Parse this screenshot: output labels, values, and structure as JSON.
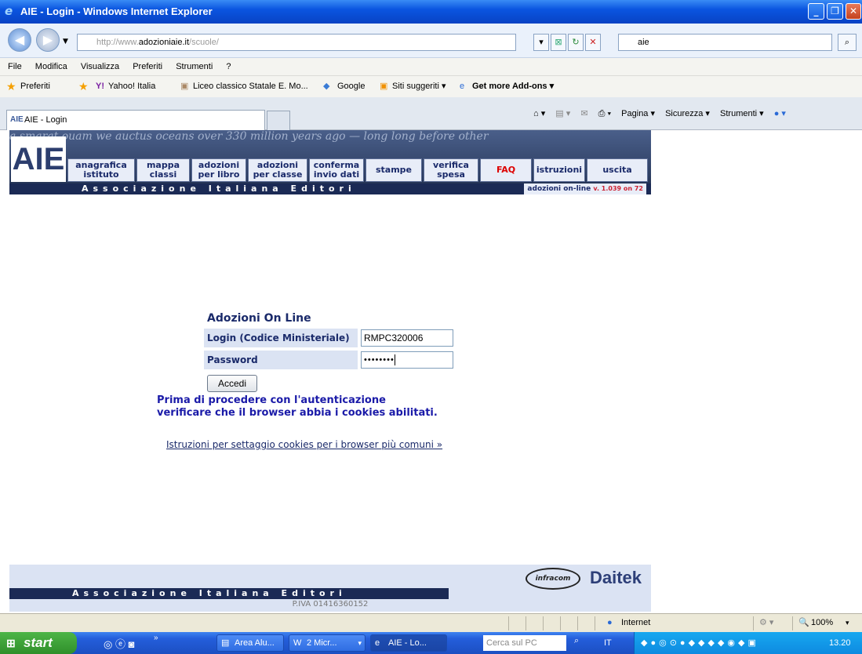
{
  "window": {
    "title": "AIE - Login - Windows Internet Explorer"
  },
  "browser": {
    "url_prefix": "http://www.",
    "url_host": "adozioniaie.it",
    "url_path": "/scuole/",
    "search_value": "aie",
    "menu": [
      "File",
      "Modifica",
      "Visualizza",
      "Preferiti",
      "Strumenti",
      "?"
    ],
    "favorites_label": "Preferiti",
    "favorites": [
      "Yahoo! Italia",
      "Liceo classico Statale E. Mo...",
      "Google",
      "Siti suggeriti ▾",
      "Get more Add-ons ▾"
    ],
    "tab_title": "AIE - Login",
    "commands": [
      "Pagina ▾",
      "Sicurezza ▾",
      "Strumenti ▾"
    ],
    "status_zone": "Internet",
    "zoom": "100%"
  },
  "site": {
    "logo": "AIE",
    "banner_script": "a smarat ouam we auctus oceans over 330 million years ago — long long before other",
    "nav": [
      {
        "l1": "anagrafica",
        "l2": "istituto"
      },
      {
        "l1": "mappa",
        "l2": "classi"
      },
      {
        "l1": "adozioni",
        "l2": "per libro"
      },
      {
        "l1": "adozioni",
        "l2": "per classe"
      },
      {
        "l1": "conferma",
        "l2": "invio dati"
      },
      {
        "l1": "stampe",
        "l2": ""
      },
      {
        "l1": "verifica",
        "l2": "spesa"
      },
      {
        "l1": "FAQ",
        "l2": ""
      },
      {
        "l1": "istruzioni",
        "l2": ""
      },
      {
        "l1": "uscita",
        "l2": ""
      }
    ],
    "assoc_text": "Associazione Italiana Editori",
    "version_label": "adozioni on-line",
    "version": "v. 1.039 on 72"
  },
  "login": {
    "title": "Adozioni On Line",
    "login_label": "Login (Codice Ministeriale)",
    "login_value": "RMPC320006",
    "password_label": "Password",
    "password_value": "••••••••",
    "submit": "Accedi",
    "warning_line1": "Prima di procedere con l'autenticazione",
    "warning_line2": "verificare che il browser abbia i cookies abilitati.",
    "cookie_link": "Istruzioni per settaggio cookies per i browser più comuni »"
  },
  "footer": {
    "piva": "P.IVA 01416360152",
    "infracom": "infracom",
    "daitek": "Daitek"
  },
  "taskbar": {
    "start": "start",
    "items": [
      "Area Alu...",
      "2 Micr...",
      "AIE - Lo..."
    ],
    "search_placeholder": "Cerca sul PC",
    "lang": "IT",
    "clock": "13.20"
  }
}
